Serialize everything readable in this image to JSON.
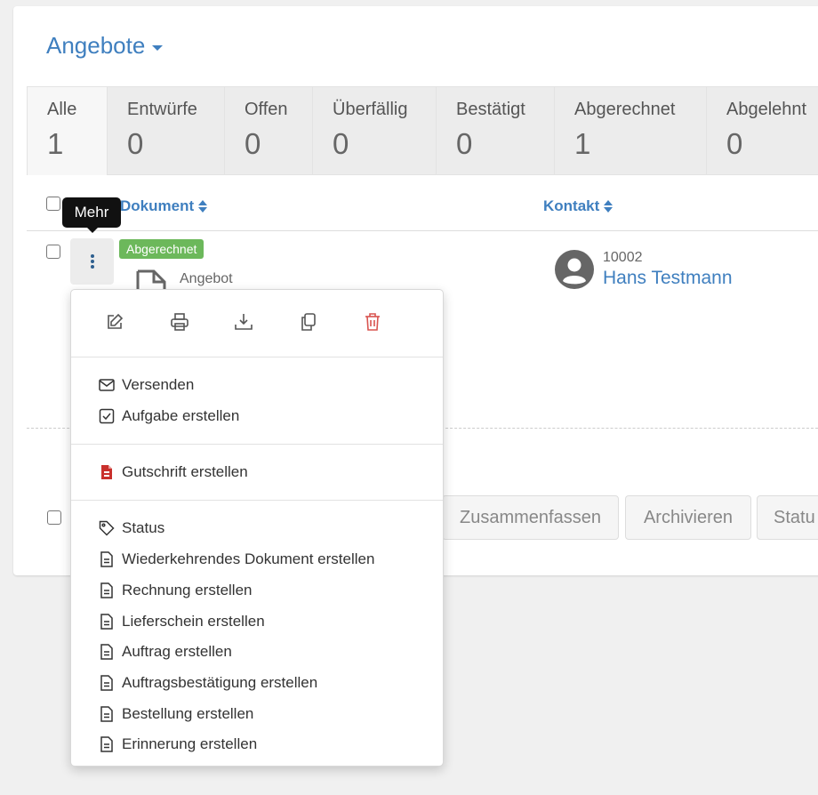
{
  "page": {
    "title": "Angebote"
  },
  "tabs": [
    {
      "label": "Alle",
      "count": "1"
    },
    {
      "label": "Entwürfe",
      "count": "0"
    },
    {
      "label": "Offen",
      "count": "0"
    },
    {
      "label": "Überfällig",
      "count": "0"
    },
    {
      "label": "Bestätigt",
      "count": "0"
    },
    {
      "label": "Abgerechnet",
      "count": "1"
    },
    {
      "label": "Abgelehnt",
      "count": "0"
    }
  ],
  "table": {
    "col_document": "Dokument",
    "col_contact": "Kontakt"
  },
  "row": {
    "tooltip": "Mehr",
    "status": "Abgerechnet",
    "doc_type": "Angebot",
    "contact_number": "10002",
    "contact_name": "Hans Testmann"
  },
  "bulk": {
    "merge": "Zusammenfassen",
    "archive": "Archivieren",
    "status": "Statu"
  },
  "menu": {
    "quick_actions": [
      "edit-icon",
      "print-icon",
      "download-icon",
      "copy-icon",
      "trash-icon"
    ],
    "group1": [
      {
        "icon": "envelope-icon",
        "label": "Versenden"
      },
      {
        "icon": "checkbox-icon",
        "label": "Aufgabe erstellen"
      }
    ],
    "group2": [
      {
        "icon": "credit-note-icon",
        "label": "Gutschrift erstellen"
      }
    ],
    "group3": [
      {
        "icon": "tag-icon",
        "label": "Status"
      },
      {
        "icon": "document-icon",
        "label": "Wiederkehrendes Dokument erstellen"
      },
      {
        "icon": "document-icon",
        "label": "Rechnung erstellen"
      },
      {
        "icon": "document-icon",
        "label": "Lieferschein erstellen"
      },
      {
        "icon": "document-icon",
        "label": "Auftrag erstellen"
      },
      {
        "icon": "document-icon",
        "label": "Auftragsbestätigung erstellen"
      },
      {
        "icon": "document-icon",
        "label": "Bestellung erstellen"
      },
      {
        "icon": "document-icon",
        "label": "Erinnerung erstellen"
      }
    ]
  },
  "colors": {
    "accent": "#3f7fbf",
    "badge_green": "#6cb85b",
    "danger": "#d9534f"
  }
}
